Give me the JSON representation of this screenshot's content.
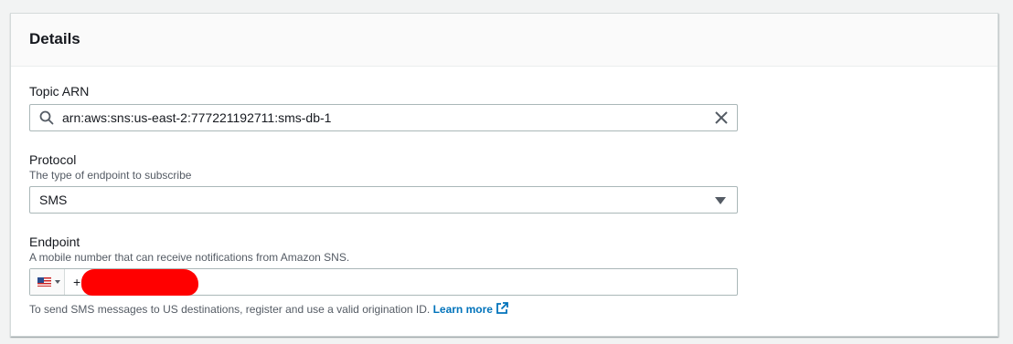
{
  "panel": {
    "title": "Details"
  },
  "topic_arn": {
    "label": "Topic ARN",
    "value": "arn:aws:sns:us-east-2:777221192711:sms-db-1",
    "search_icon": "search-icon",
    "clear_icon": "close-icon"
  },
  "protocol": {
    "label": "Protocol",
    "description": "The type of endpoint to subscribe",
    "value": "SMS",
    "caret_icon": "caret-down-icon"
  },
  "endpoint": {
    "label": "Endpoint",
    "description": "A mobile number that can receive notifications from Amazon SNS.",
    "country_flag": "us-flag-icon",
    "prefix": "+",
    "help_text": "To send SMS messages to US destinations, register and use a valid origination ID.",
    "learn_more": "Learn more",
    "external_icon": "external-link-icon"
  },
  "colors": {
    "link": "#0073bb",
    "border": "#aab7b8",
    "redaction": "#ff0000"
  }
}
